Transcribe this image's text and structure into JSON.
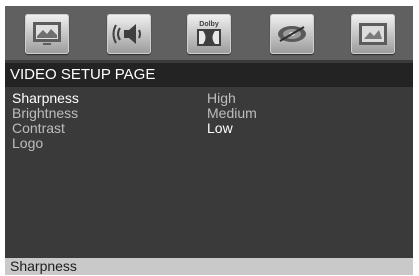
{
  "icons": [
    "tv-monitor-icon",
    "speaker-sound-icon",
    "dolby-digital-icon",
    "disc-icon",
    "picture-icon"
  ],
  "icon_labels": {
    "dolby": "Dolby"
  },
  "page_title": "VIDEO SETUP PAGE",
  "settings": [
    {
      "label": "Sharpness",
      "selected": true
    },
    {
      "label": "Brightness",
      "selected": false
    },
    {
      "label": "Contrast",
      "selected": false
    },
    {
      "label": "Logo",
      "selected": false
    }
  ],
  "options": [
    {
      "label": "High",
      "current": false
    },
    {
      "label": "Medium",
      "current": false
    },
    {
      "label": "Low",
      "current": true
    }
  ],
  "status_text": "Sharpness",
  "colors": {
    "screen": "#3a3a3a",
    "icon_bar": "#606060",
    "title_bar": "#232323",
    "status_bar": "#c9c9c9",
    "text_selected": "#ffffff",
    "text_normal": "#bdbdbd"
  }
}
